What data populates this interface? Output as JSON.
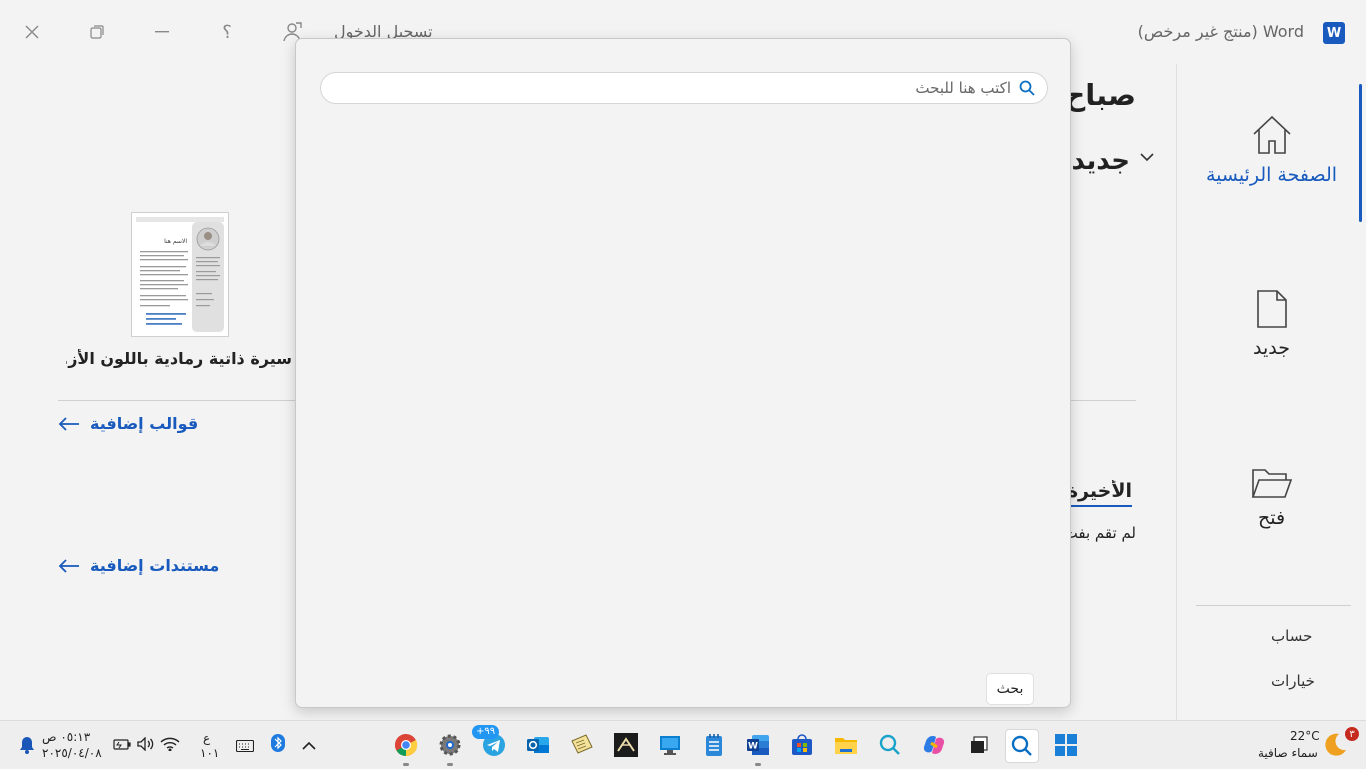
{
  "titlebar": {
    "title": "Word (منتج غير مرخص)",
    "app_icon_letter": "W",
    "signin_label": "تسجيل الدخول",
    "help_glyph": "؟",
    "close_glyph": "✕",
    "minimize_glyph": "—"
  },
  "nav": {
    "items": [
      {
        "label": "الصفحة الرئيسية",
        "icon": "home-icon"
      },
      {
        "label": "جديد",
        "icon": "new-document-icon"
      },
      {
        "label": "فتح",
        "icon": "folder-open-icon"
      }
    ],
    "account_label": "حساب",
    "options_label": "خيارات"
  },
  "home": {
    "greeting": "صباح",
    "new_heading": "جديد",
    "recent_heading": "الأخيرة",
    "recent_empty_note": "لم تقم بفت",
    "template_title": "سيرة ذاتية رمادية باللون الأز...",
    "template_thumb_name": "الاسم هنا",
    "more_templates": "قوالب إضافية",
    "more_documents": "مستندات إضافية"
  },
  "search": {
    "placeholder": "اكتب هنا للبحث",
    "value": "",
    "button_label": "بحث"
  },
  "taskbar": {
    "weather_temp": "22°C",
    "weather_desc": "سماء صافية",
    "notification_count": "٣",
    "telegram_badge": "+٩٩",
    "lang_top": "ع",
    "lang_bottom": "١٠١",
    "clock_time": "٠٥:١٣ ص",
    "clock_date": "٢٠٢٥/٠٤/٠٨",
    "apps": [
      "start-icon",
      "search-icon",
      "task-view-icon",
      "copilot-icon",
      "search-icon",
      "file-explorer-icon",
      "store-icon",
      "word-icon",
      "notepad-icon",
      "remote-desktop-icon",
      "app-icon",
      "notes-icon",
      "outlook-icon",
      "telegram-icon",
      "settings-icon",
      "chrome-icon"
    ]
  },
  "colors": {
    "accent": "#185abd",
    "background": "#f3f3f3",
    "taskbar": "#eeeeee"
  }
}
